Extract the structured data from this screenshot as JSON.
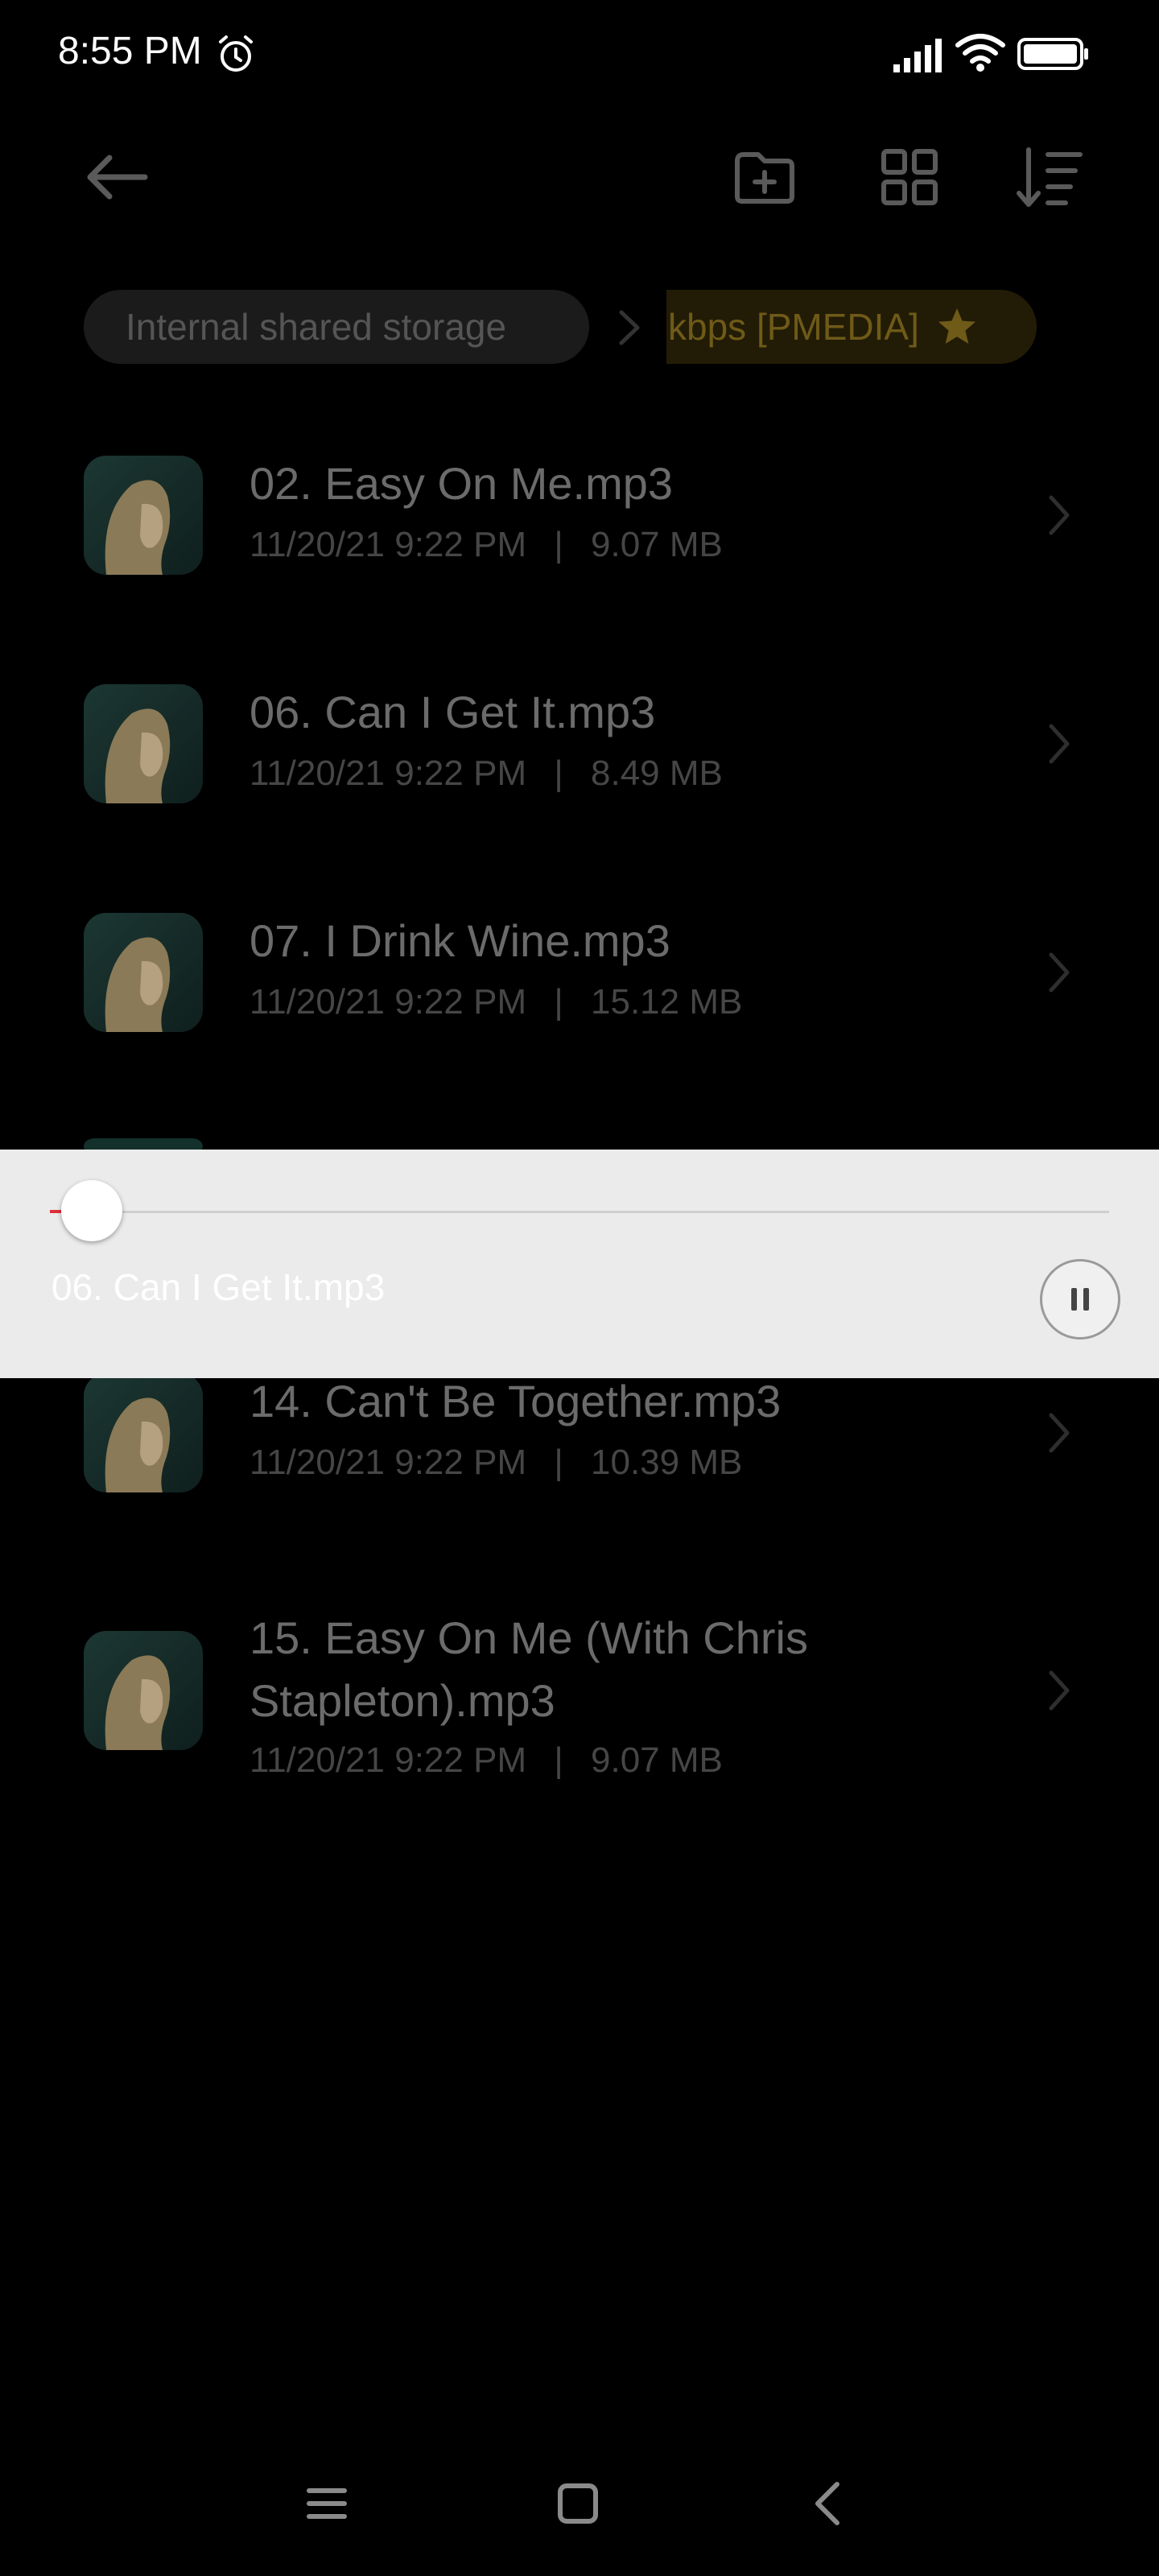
{
  "status_bar": {
    "time": "8:55 PM",
    "icons": [
      "alarm-icon",
      "signal-icon",
      "wifi-icon",
      "battery-icon"
    ]
  },
  "toolbar": {
    "icons": [
      "back-arrow-icon",
      "new-folder-icon",
      "grid-view-icon",
      "sort-icon"
    ]
  },
  "breadcrumb": {
    "root": "Internal shared storage",
    "current": "kbps [PMEDIA]",
    "current_icon": "star-icon"
  },
  "files": [
    {
      "name": "02. Easy On Me.mp3",
      "date": "11/20/21 9:22 PM",
      "size": "9.07 MB"
    },
    {
      "name": "06. Can I Get It.mp3",
      "date": "11/20/21 9:22 PM",
      "size": "8.49 MB"
    },
    {
      "name": "07. I Drink Wine.mp3",
      "date": "11/20/21 9:22 PM",
      "size": "15.12 MB"
    },
    {
      "name": "14. Can't Be Together.mp3",
      "date": "11/20/21 9:22 PM",
      "size": "10.39 MB"
    },
    {
      "name_line1": "15. Easy On Me (With Chris",
      "name_line2": "Stapleton).mp3",
      "date": "11/20/21 9:22 PM",
      "size": "9.07 MB"
    }
  ],
  "meta_separator": "|",
  "player": {
    "title": "06. Can I Get It.mp3",
    "progress": 0.02,
    "state_icon": "pause-icon"
  },
  "nav_bar": {
    "icons": [
      "menu-icon",
      "home-icon",
      "back-icon"
    ]
  },
  "colors": {
    "background": "#000000",
    "player_background": "#EBEBEB",
    "progress_accent": "#E0303A",
    "breadcrumb_accent": "#6F5A18"
  }
}
